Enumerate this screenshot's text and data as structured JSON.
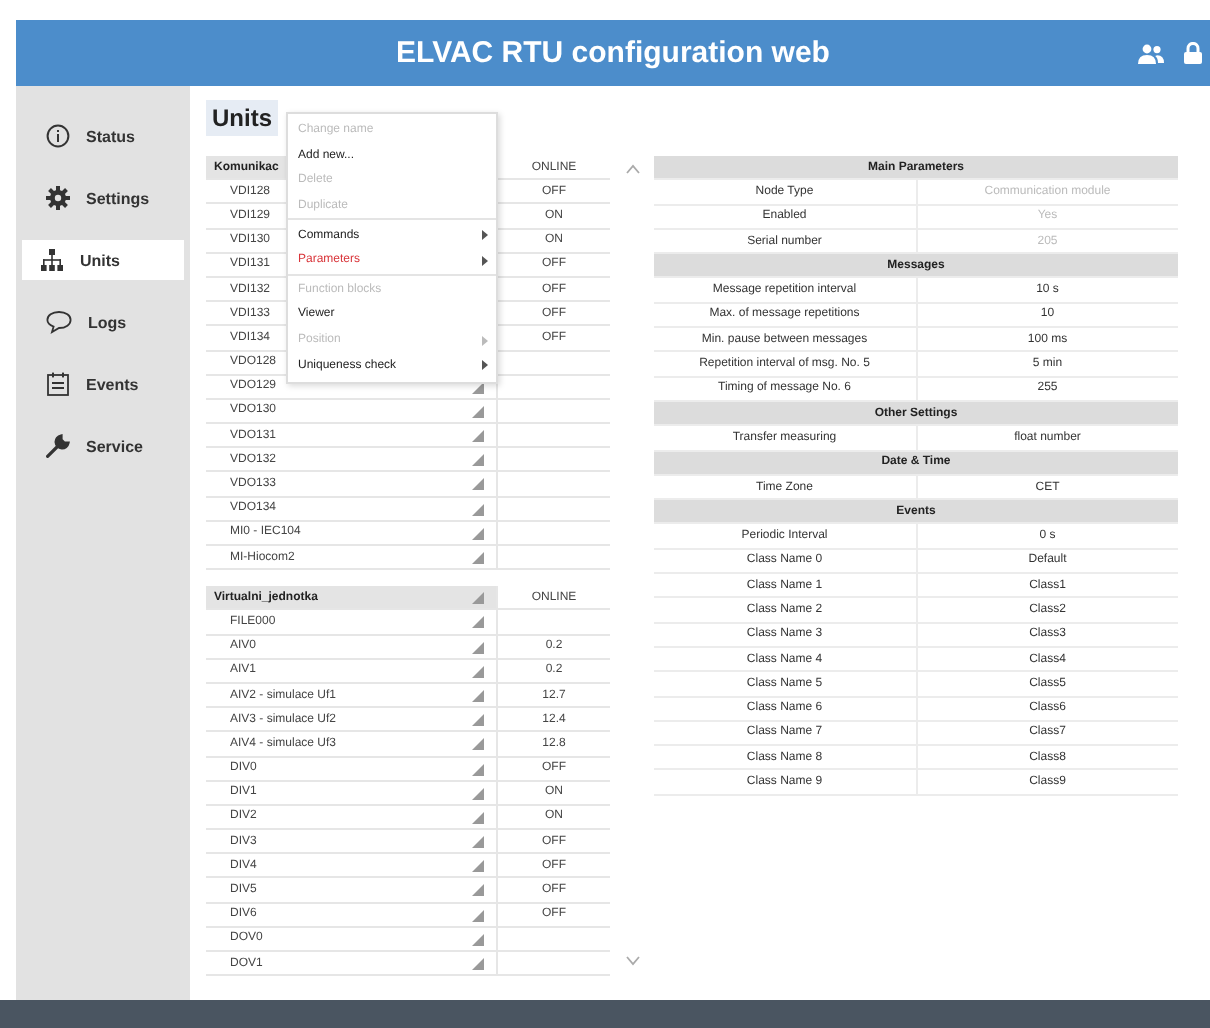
{
  "header": {
    "title": "ELVAC RTU configuration web"
  },
  "sidebar": {
    "items": [
      {
        "label": "Status",
        "selected": false
      },
      {
        "label": "Settings",
        "selected": false
      },
      {
        "label": "Units",
        "selected": true
      },
      {
        "label": "Logs",
        "selected": false
      },
      {
        "label": "Events",
        "selected": false
      },
      {
        "label": "Service",
        "selected": false
      }
    ]
  },
  "page_title": "Units",
  "unit_tables": [
    {
      "name": "Komunikac",
      "status_heading": "ONLINE",
      "rows": [
        {
          "name": "VDI128",
          "status": "OFF"
        },
        {
          "name": "VDI129",
          "status": "ON"
        },
        {
          "name": "VDI130",
          "status": "ON"
        },
        {
          "name": "VDI131",
          "status": "OFF"
        },
        {
          "name": "VDI132",
          "status": "OFF"
        },
        {
          "name": "VDI133",
          "status": "OFF"
        },
        {
          "name": "VDI134",
          "status": "OFF"
        },
        {
          "name": "VDO128",
          "status": ""
        },
        {
          "name": "VDO129",
          "status": "",
          "handle": true
        },
        {
          "name": "VDO130",
          "status": "",
          "handle": true
        },
        {
          "name": "VDO131",
          "status": "",
          "handle": true
        },
        {
          "name": "VDO132",
          "status": "",
          "handle": true
        },
        {
          "name": "VDO133",
          "status": "",
          "handle": true
        },
        {
          "name": "VDO134",
          "status": "",
          "handle": true
        },
        {
          "name": "MI0 - IEC104",
          "status": "",
          "handle": true
        },
        {
          "name": "MI-Hiocom2",
          "status": "",
          "handle": true
        }
      ]
    },
    {
      "name": "Virtualni_jednotka",
      "status_heading": "ONLINE",
      "handle": true,
      "rows": [
        {
          "name": "FILE000",
          "status": "",
          "handle": true
        },
        {
          "name": "AIV0",
          "status": "0.2",
          "handle": true
        },
        {
          "name": "AIV1",
          "status": "0.2",
          "handle": true
        },
        {
          "name": "AIV2 - simulace Uf1",
          "status": "12.7",
          "handle": true
        },
        {
          "name": "AIV3 - simulace Uf2",
          "status": "12.4",
          "handle": true
        },
        {
          "name": "AIV4 - simulace Uf3",
          "status": "12.8",
          "handle": true
        },
        {
          "name": "DIV0",
          "status": "OFF",
          "handle": true
        },
        {
          "name": "DIV1",
          "status": "ON",
          "handle": true
        },
        {
          "name": "DIV2",
          "status": "ON",
          "handle": true
        },
        {
          "name": "DIV3",
          "status": "OFF",
          "handle": true
        },
        {
          "name": "DIV4",
          "status": "OFF",
          "handle": true
        },
        {
          "name": "DIV5",
          "status": "OFF",
          "handle": true
        },
        {
          "name": "DIV6",
          "status": "OFF",
          "handle": true
        },
        {
          "name": "DOV0",
          "status": "",
          "handle": true
        },
        {
          "name": "DOV1",
          "status": "",
          "handle": true
        }
      ]
    }
  ],
  "context_menu": {
    "items": [
      {
        "label": "Change name",
        "disabled": true,
        "submenu": false,
        "selected": false,
        "divider_after": false
      },
      {
        "label": "Add new...",
        "disabled": false,
        "submenu": false,
        "selected": false,
        "divider_after": false
      },
      {
        "label": "Delete",
        "disabled": true,
        "submenu": false,
        "selected": false,
        "divider_after": false
      },
      {
        "label": "Duplicate",
        "disabled": true,
        "submenu": false,
        "selected": false,
        "divider_after": true
      },
      {
        "label": "Commands",
        "disabled": false,
        "submenu": true,
        "selected": false,
        "divider_after": false
      },
      {
        "label": "Parameters",
        "disabled": false,
        "submenu": true,
        "selected": true,
        "divider_after": true
      },
      {
        "label": "Function blocks",
        "disabled": true,
        "submenu": false,
        "selected": false,
        "divider_after": false
      },
      {
        "label": "Viewer",
        "disabled": false,
        "submenu": false,
        "selected": false,
        "divider_after": false
      },
      {
        "label": "Position",
        "disabled": true,
        "submenu": true,
        "selected": false,
        "divider_after": false
      },
      {
        "label": "Uniqueness check",
        "disabled": false,
        "submenu": true,
        "selected": false,
        "divider_after": false
      }
    ]
  },
  "parameters": {
    "sections": [
      {
        "title": "Main Parameters",
        "rows": [
          {
            "label": "Node Type",
            "value": "Communication module",
            "disabled": true
          },
          {
            "label": "Enabled",
            "value": "Yes",
            "disabled": true
          },
          {
            "label": "Serial number",
            "value": "205",
            "disabled": true
          }
        ]
      },
      {
        "title": "Messages",
        "rows": [
          {
            "label": "Message repetition interval",
            "value": "10 s",
            "disabled": false
          },
          {
            "label": "Max. of message repetitions",
            "value": "10",
            "disabled": false
          },
          {
            "label": "Min. pause between messages",
            "value": "100 ms",
            "disabled": false
          },
          {
            "label": "Repetition interval of msg. No. 5",
            "value": "5 min",
            "disabled": false
          },
          {
            "label": "Timing of message No. 6",
            "value": "255",
            "disabled": false
          }
        ]
      },
      {
        "title": "Other Settings",
        "rows": [
          {
            "label": "Transfer measuring",
            "value": "float number",
            "disabled": false
          }
        ]
      },
      {
        "title": "Date & Time",
        "rows": [
          {
            "label": "Time Zone",
            "value": "CET",
            "disabled": false
          }
        ]
      },
      {
        "title": "Events",
        "rows": [
          {
            "label": "Periodic Interval",
            "value": "0 s",
            "disabled": false
          },
          {
            "label": "Class Name 0",
            "value": "Default",
            "disabled": false
          },
          {
            "label": "Class Name 1",
            "value": "Class1",
            "disabled": false
          },
          {
            "label": "Class Name 2",
            "value": "Class2",
            "disabled": false
          },
          {
            "label": "Class Name 3",
            "value": "Class3",
            "disabled": false
          },
          {
            "label": "Class Name 4",
            "value": "Class4",
            "disabled": false
          },
          {
            "label": "Class Name 5",
            "value": "Class5",
            "disabled": false
          },
          {
            "label": "Class Name 6",
            "value": "Class6",
            "disabled": false
          },
          {
            "label": "Class Name 7",
            "value": "Class7",
            "disabled": false
          },
          {
            "label": "Class Name 8",
            "value": "Class8",
            "disabled": false
          },
          {
            "label": "Class Name 9",
            "value": "Class9",
            "disabled": false
          }
        ]
      }
    ]
  }
}
